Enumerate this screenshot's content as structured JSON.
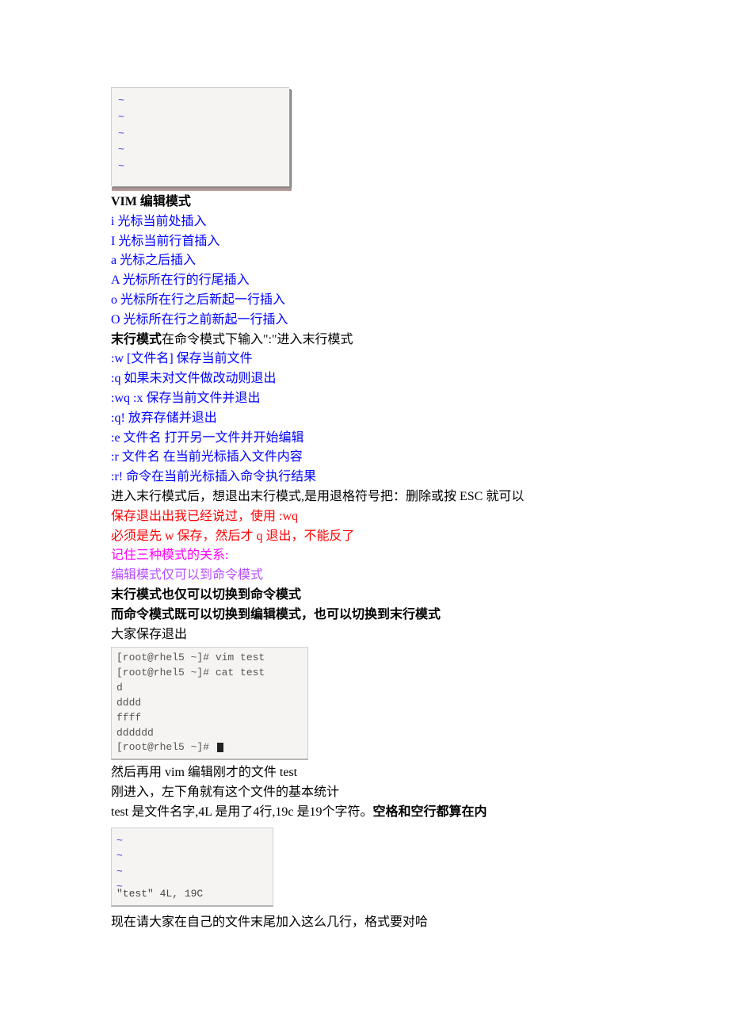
{
  "vimbox1": {
    "tilde": "~"
  },
  "heading_editmode": "VIM 编辑模式",
  "edit_cmds": [
    "i 光标当前处插入",
    " I 光标当前行首插入",
    " a 光标之后插入",
    " A 光标所在行的行尾插入",
    " o 光标所在行之后新起一行插入",
    " O 光标所在行之前新起一行插入"
  ],
  "lastline_intro_bold": "末行模式",
  "lastline_intro_rest": "在命令模式下输入\":\"进入末行模式",
  "last_cmds": [
    ":w [文件名] 保存当前文件",
    " :q  如果未对文件做改动则退出",
    " :wq :x  保存当前文件并退出",
    " :q!  放弃存储并退出",
    " :e 文件名 打开另一文件并开始编辑",
    " :r 文件名 在当前光标插入文件内容",
    " :r! 命令在当前光标插入命令执行结果"
  ],
  "after_lastcmds": "进入末行模式后，想退出末行模式,是用退格符号把：删除或按 ESC 就可以",
  "red1": "保存退出出我已经说过，使用 :wq",
  "red2": "必须是先 w 保存，然后才 q 退出，不能反了",
  "magenta": "记住三种模式的关系:",
  "violet": "编辑模式仅可以到命令模式",
  "bold1": "末行模式也仅可以切换到命令模式",
  "bold2": "而命令模式既可以切换到编辑模式，也可以切换到末行模式",
  "save_exit": "大家保存退出",
  "term1": "[root@rhel5 ~]# vim test\n[root@rhel5 ~]# cat test\nd\ndddd\nffff\ndddddd\n[root@rhel5 ~]# ",
  "after_term1_l1": "然后再用 vim 编辑刚才的文件 test",
  "after_term1_l2": "刚进入，左下角就有这个文件的基本统计",
  "after_term1_l3a": "test 是文件名字,4L 是用了4行,19c 是19个字符。",
  "after_term1_l3b": "空格和空行都算在内",
  "term2_status": "\"test\" 4L, 19C",
  "final_line": "现在请大家在自己的文件末尾加入这么几行，格式要对哈"
}
